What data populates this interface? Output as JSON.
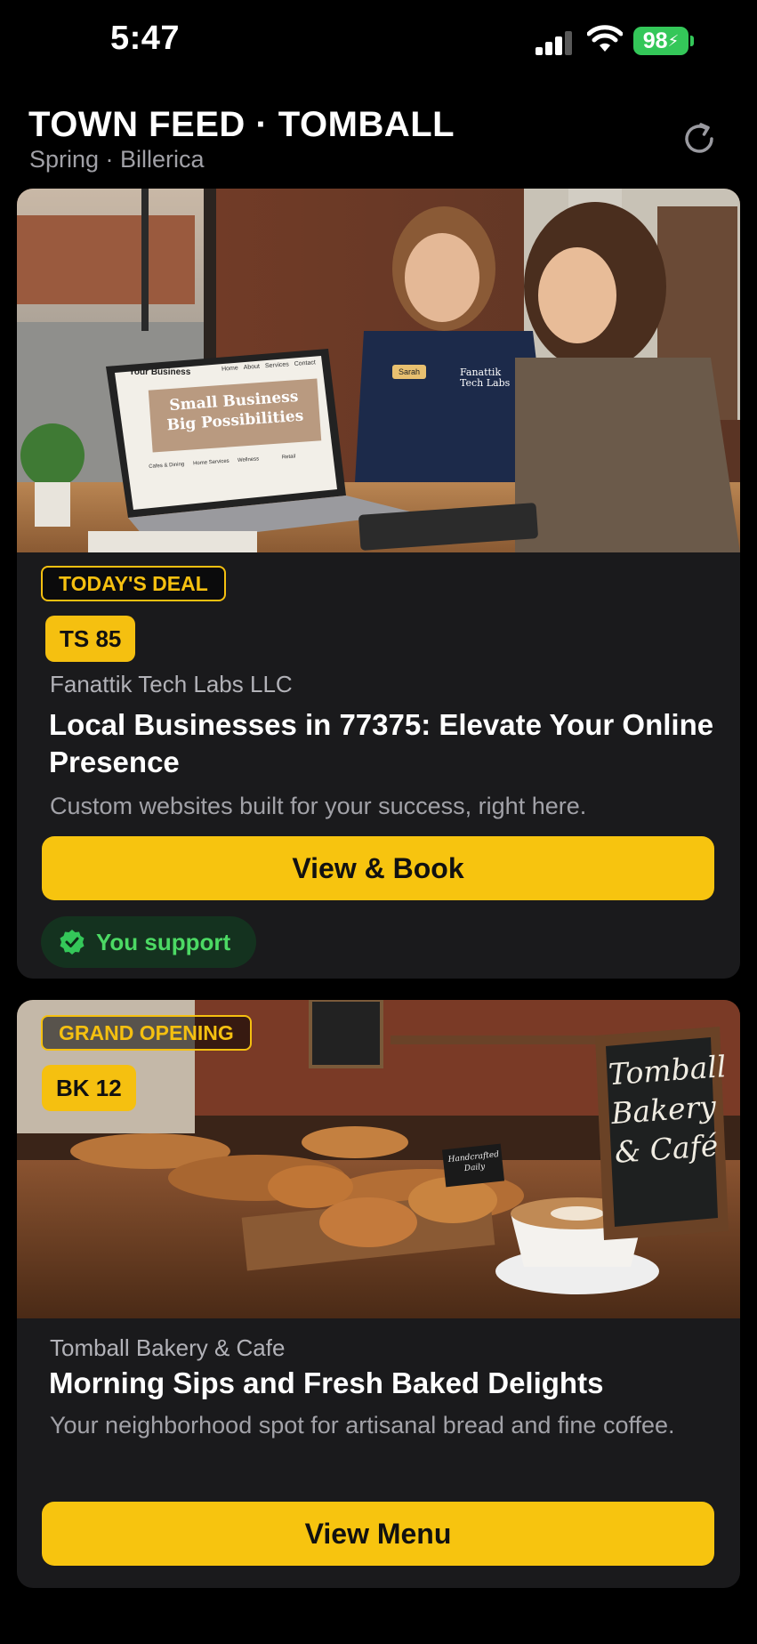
{
  "status_bar": {
    "time": "5:47",
    "battery": "98"
  },
  "header": {
    "title": "TOWN FEED · TOMBALL",
    "subtitle": "Spring · Billerica"
  },
  "cards": [
    {
      "tag": "TODAY'S DEAL",
      "code": "TS 85",
      "business": "Fanattik Tech Labs LLC",
      "title": "Local Businesses in 77375: Elevate Your Online Presence",
      "description": "Custom websites built for your success, right here.",
      "cta": "View & Book",
      "support_label": "You support",
      "image": {
        "site_header": "Your Business",
        "site_nav": [
          "Home",
          "About",
          "Services",
          "Contact"
        ],
        "site_headline_1": "Small Business",
        "site_headline_2": "Big Possibilities",
        "site_tiles": [
          "Cafes & Dining",
          "Home Services",
          "Wellness",
          "Retail"
        ],
        "name_tag": "Sarah",
        "shirt_logo_1": "Fanattik",
        "shirt_logo_2": "Tech Labs"
      }
    },
    {
      "tag": "GRAND OPENING",
      "code": "BK 12",
      "business": "Tomball Bakery & Cafe",
      "title": "Morning Sips and Fresh Baked Delights",
      "description": "Your neighborhood spot for artisanal bread and fine coffee.",
      "cta": "View Menu",
      "image": {
        "chalkboard_1": "Tomball",
        "chalkboard_2": "Bakery",
        "chalkboard_3": "& Café",
        "small_sign_1": "Handcrafted",
        "small_sign_2": "Daily"
      }
    }
  ],
  "colors": {
    "accent": "#f7c40f",
    "support_green": "#4cd964",
    "card_bg": "#1a1a1c"
  },
  "icons": [
    "signal-icon",
    "wifi-icon",
    "battery-icon",
    "refresh-icon",
    "verified-check-icon"
  ]
}
